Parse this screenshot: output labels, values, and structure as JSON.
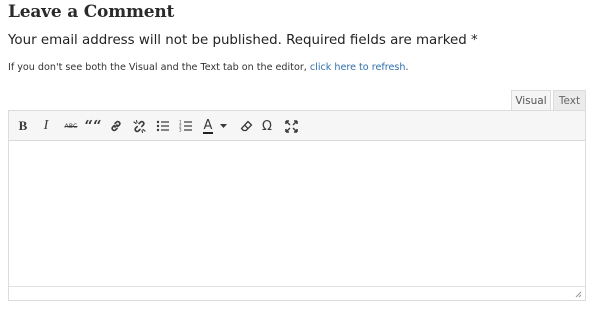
{
  "comment": {
    "heading": "Leave a Comment",
    "notice": "Your email address will not be published. Required fields are marked *",
    "refresh_note_prefix": "If you don't see both the Visual and the Text tab on the editor, ",
    "refresh_link": "click here to refresh",
    "refresh_note_suffix": "."
  },
  "editor": {
    "tabs": [
      {
        "label": "Visual",
        "active": true
      },
      {
        "label": "Text",
        "active": false
      }
    ],
    "toolbar": {
      "bold": "B",
      "italic": "I",
      "strikethrough": "ABC",
      "blockquote": "““",
      "text_color": "A",
      "special_character": "Ω",
      "icons": [
        "bold-icon",
        "italic-icon",
        "strikethrough-icon",
        "blockquote-icon",
        "link-icon",
        "unlink-icon",
        "bulleted-list-icon",
        "numbered-list-icon",
        "text-color-icon",
        "dropdown-arrow-icon",
        "clear-formatting-icon",
        "special-character-icon",
        "fullscreen-icon"
      ]
    },
    "content": ""
  },
  "colors": {
    "link": "#2c6fad",
    "toolbar_bg": "#f6f6f6",
    "border": "#dcdcdc"
  }
}
